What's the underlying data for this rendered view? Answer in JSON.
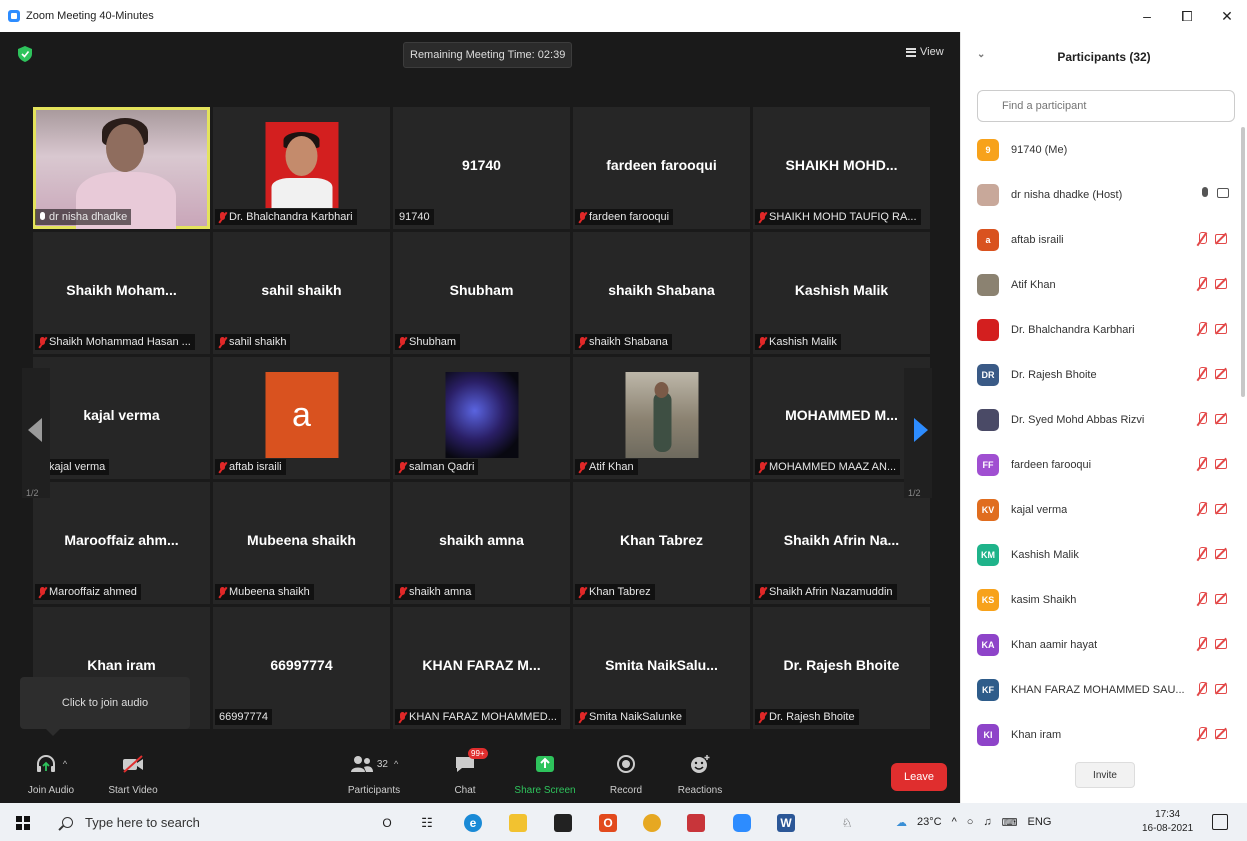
{
  "window": {
    "title": "Zoom Meeting 40-Minutes",
    "minimize": "–",
    "maximize": "⧠",
    "close": "✕"
  },
  "topbar": {
    "remaining": "Remaining Meeting Time: 02:39",
    "view": "View"
  },
  "tiles": [
    {
      "big": "",
      "label": "dr nisha dhadke",
      "mic": "on",
      "pic": "nisha",
      "active": true
    },
    {
      "big": "",
      "label": "Dr. Bhalchandra Karbhari",
      "mic": "muted",
      "pic": "karbhari"
    },
    {
      "big": "91740",
      "label": "91740",
      "mic": "none"
    },
    {
      "big": "fardeen farooqui",
      "label": "fardeen farooqui",
      "mic": "muted"
    },
    {
      "big": "SHAIKH MOHD...",
      "label": "SHAIKH MOHD TAUFIQ RA...",
      "mic": "muted"
    },
    {
      "big": "Shaikh Moham...",
      "label": "Shaikh Mohammad Hasan ...",
      "mic": "muted"
    },
    {
      "big": "sahil shaikh",
      "label": "sahil shaikh",
      "mic": "muted"
    },
    {
      "big": "Shubham",
      "label": "Shubham",
      "mic": "muted"
    },
    {
      "big": "shaikh Shabana",
      "label": "shaikh Shabana",
      "mic": "muted"
    },
    {
      "big": "Kashish Malik",
      "label": "Kashish Malik",
      "mic": "muted"
    },
    {
      "big": "kajal verma",
      "label": "kajal verma",
      "mic": "muted"
    },
    {
      "big": "",
      "label": "aftab israili",
      "mic": "muted",
      "pic": "aftab",
      "pic_letter": "a"
    },
    {
      "big": "",
      "label": "salman Qadri",
      "mic": "muted",
      "pic": "salman"
    },
    {
      "big": "",
      "label": "Atif Khan",
      "mic": "muted",
      "pic": "atif"
    },
    {
      "big": "MOHAMMED M...",
      "label": "MOHAMMED MAAZ AN...",
      "mic": "muted"
    },
    {
      "big": "Marooffaiz ahm...",
      "label": "Marooffaiz ahmed",
      "mic": "muted"
    },
    {
      "big": "Mubeena shaikh",
      "label": "Mubeena shaikh",
      "mic": "muted"
    },
    {
      "big": "shaikh amna",
      "label": "shaikh amna",
      "mic": "muted"
    },
    {
      "big": "Khan Tabrez",
      "label": "Khan Tabrez",
      "mic": "muted"
    },
    {
      "big": "Shaikh Afrin Na...",
      "label": "Shaikh Afrin Nazamuddin",
      "mic": "muted"
    },
    {
      "big": "Khan iram",
      "label": "",
      "mic": "none"
    },
    {
      "big": "66997774",
      "label": "66997774",
      "mic": "none"
    },
    {
      "big": "KHAN FARAZ M...",
      "label": "KHAN FARAZ MOHAMMED...",
      "mic": "muted"
    },
    {
      "big": "Smita NaikSalu...",
      "label": "Smita NaikSalunke",
      "mic": "muted"
    },
    {
      "big": "Dr. Rajesh Bhoite",
      "label": "Dr. Rajesh Bhoite",
      "mic": "muted"
    }
  ],
  "pager": {
    "left": "1/2",
    "right": "1/2"
  },
  "audio_tip": "Click to join audio",
  "toolbar": {
    "join_audio": "Join Audio",
    "start_video": "Start Video",
    "participants": "Participants",
    "participants_count": "32",
    "chat": "Chat",
    "chat_badge": "99+",
    "share_screen": "Share Screen",
    "record": "Record",
    "reactions": "Reactions",
    "leave": "Leave"
  },
  "panel": {
    "title": "Participants (32)",
    "search_placeholder": "Find a participant",
    "invite": "Invite",
    "participants": [
      {
        "initials": "9",
        "name": "91740 (Me)",
        "color": "#f7a21b",
        "status": "none"
      },
      {
        "initials": "",
        "name": "dr nisha dhadke (Host)",
        "color": "#c8a89a",
        "status": "on"
      },
      {
        "initials": "a",
        "name": "aftab israili",
        "color": "#d9521f",
        "status": "muted"
      },
      {
        "initials": "",
        "name": "Atif Khan",
        "color": "#8b8271",
        "status": "muted"
      },
      {
        "initials": "",
        "name": "Dr. Bhalchandra Karbhari",
        "color": "#d31f1f",
        "status": "muted"
      },
      {
        "initials": "DR",
        "name": "Dr. Rajesh Bhoite",
        "color": "#3a5a86",
        "status": "muted"
      },
      {
        "initials": "",
        "name": "Dr. Syed Mohd Abbas Rizvi",
        "color": "#4a4a66",
        "status": "muted"
      },
      {
        "initials": "FF",
        "name": "fardeen farooqui",
        "color": "#a04fd1",
        "status": "muted"
      },
      {
        "initials": "KV",
        "name": "kajal verma",
        "color": "#e06d1f",
        "status": "muted"
      },
      {
        "initials": "KM",
        "name": "Kashish Malik",
        "color": "#1fb38a",
        "status": "muted"
      },
      {
        "initials": "KS",
        "name": "kasim Shaikh",
        "color": "#f7a21b",
        "status": "muted"
      },
      {
        "initials": "KA",
        "name": "Khan aamir hayat",
        "color": "#8e44c9",
        "status": "muted"
      },
      {
        "initials": "KF",
        "name": "KHAN FARAZ MOHAMMED SAU...",
        "color": "#2e5c8a",
        "status": "muted"
      },
      {
        "initials": "KI",
        "name": "Khan iram",
        "color": "#8e44c9",
        "status": "muted"
      }
    ]
  },
  "taskbar": {
    "search": "Type here to search",
    "weather": "23°C",
    "lang": "ENG",
    "time": "17:34",
    "date": "16-08-2021"
  }
}
